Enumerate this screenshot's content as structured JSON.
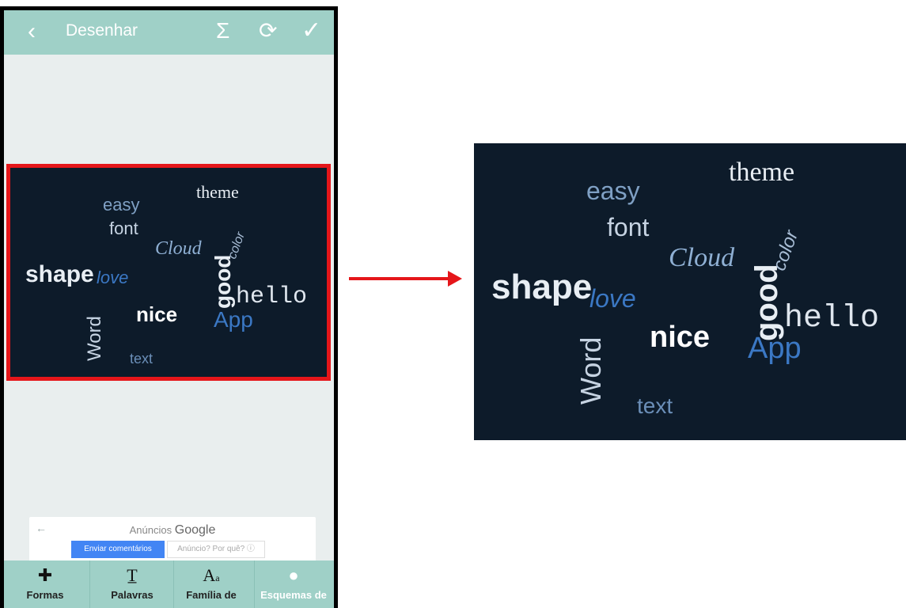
{
  "app": {
    "title": "Desenhar",
    "back_icon": "back-arrow-icon",
    "icons": [
      "sigma-icon",
      "refresh-icon",
      "check-icon"
    ]
  },
  "words": {
    "shape": "shape",
    "nice": "nice",
    "hello": "hello",
    "good": "good",
    "theme": "theme",
    "app": "App",
    "easy": "easy",
    "font": "font",
    "cloud": "Cloud",
    "word": "Word",
    "text": "text",
    "love": "love",
    "color": "color"
  },
  "ad": {
    "label_prefix": "Anúncios",
    "label_brand": "Google",
    "feedback_button": "Enviar comentários",
    "why_button": "Anúncio? Por quê? ⓘ"
  },
  "bottom_nav": [
    {
      "label": "Formas",
      "icon": "puzzle-icon"
    },
    {
      "label": "Palavras",
      "icon": "text-icon"
    },
    {
      "label": "Família de",
      "icon": "font-icon"
    },
    {
      "label": "Esquemas de",
      "icon": "palette-icon"
    }
  ],
  "colors": {
    "accent": "#9fd0c7",
    "highlight": "#e5161a",
    "cloud_bg": "#0d1b2a"
  }
}
